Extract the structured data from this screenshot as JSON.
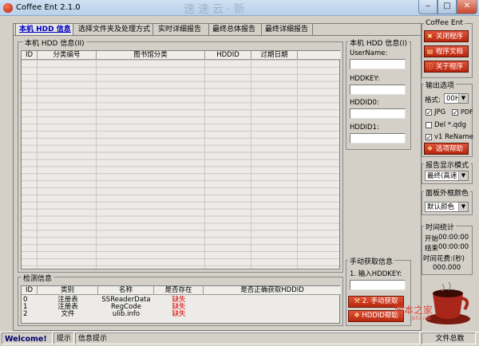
{
  "window": {
    "title": "Coffee Ent 2.1.0",
    "header_watermark": "速速云·新"
  },
  "tabs": [
    {
      "label": "本机 HDD 信息"
    },
    {
      "label": "选择文件夹及处理方式"
    },
    {
      "label": "实时详细报告"
    },
    {
      "label": "最终总体报告"
    },
    {
      "label": "最终详细报告"
    }
  ],
  "hdd_info_group": {
    "title": "本机 HDD 信息(II)",
    "columns": [
      "ID",
      "分类编号",
      "图书馆分类",
      "HDDID",
      "过期日期"
    ]
  },
  "detect_group": {
    "title": "检测信息",
    "columns": [
      "ID",
      "类别",
      "名称",
      "是否存在",
      "是否正确获取HDDID"
    ],
    "rows": [
      {
        "id": "0",
        "category": "注册表",
        "name": "SSReaderData",
        "exists": "缺失"
      },
      {
        "id": "1",
        "category": "注册表",
        "name": "RegCode",
        "exists": "缺失"
      },
      {
        "id": "2",
        "category": "文件",
        "name": "ulib.info",
        "exists": "缺失"
      }
    ]
  },
  "hdd_info_i": {
    "title": "本机 HDD 信息(I)",
    "fields": [
      {
        "label": "UserName:",
        "value": ""
      },
      {
        "label": "HDDKEY:",
        "value": ""
      },
      {
        "label": "HDDID0:",
        "value": ""
      },
      {
        "label": "HDDID1:",
        "value": ""
      }
    ]
  },
  "manual_group": {
    "title": "手动获取信息",
    "step_label": "1. 输入HDDKEY:",
    "input_value": "",
    "fetch_button": "2. 手动获取",
    "help_button": "HDDID帮助"
  },
  "coffee_group": {
    "title": "Coffee Ent",
    "buttons": [
      "关闭程序",
      "程序文档",
      "关于程序"
    ]
  },
  "output_group": {
    "title": "输出选项",
    "format_label": "格式:",
    "format_value": "00H",
    "checkboxes": [
      {
        "label": "JPG",
        "checked": true
      },
      {
        "label": "PDF",
        "checked": true
      },
      {
        "label": "Del *.qdg",
        "checked": false
      },
      {
        "label": "v1 ReName",
        "checked": true
      }
    ],
    "help_button": "选项帮助"
  },
  "report_mode": {
    "title": "报告显示模式",
    "value": "最终(高速"
  },
  "panel_color": {
    "title": "面板外框颜色",
    "value": "默认颜色"
  },
  "time_stats": {
    "title": "时间统计",
    "start_label": "开始",
    "start_value": "00:00:00",
    "end_label": "结束",
    "end_value": "00:00:00",
    "elapsed_label": "时间花费:(秒)",
    "elapsed_value": "000.000"
  },
  "logo": {
    "text": "脚本之家",
    "subtext": "jb51.net"
  },
  "statusbar": {
    "welcome": "Welcome!",
    "hint_label": "提示",
    "hint_text": "信息提示",
    "right_label": "文件总数"
  }
}
